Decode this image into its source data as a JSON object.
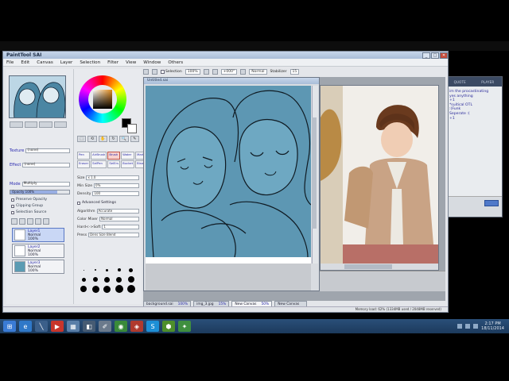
{
  "app": {
    "title": "PaintTool SAI",
    "menu": [
      "File",
      "Edit",
      "Canvas",
      "Layer",
      "Selection",
      "Filter",
      "View",
      "Window",
      "Others"
    ],
    "toolbar": {
      "zoom": "100%",
      "angle": "+000°",
      "selection_label": "Selection",
      "mode": "Normal",
      "stabilizer_label": "Stabilizer",
      "stabilizer_value": "15"
    }
  },
  "left_panel": {
    "props": [
      {
        "label": "Texture",
        "value": "(none)"
      },
      {
        "label": "Effect",
        "value": "(none)"
      },
      {
        "label": "Mode",
        "value": "Multiply"
      }
    ],
    "opacity_label": "Opacity",
    "opacity_value": "100%",
    "options": [
      "Preserve Opacity",
      "Clipping Group",
      "Selection Source"
    ],
    "layers": [
      {
        "name": "Layer1",
        "mode": "Normal",
        "opacity": "100%"
      },
      {
        "name": "Layer2",
        "mode": "Normal",
        "opacity": "100%"
      },
      {
        "name": "Layer3",
        "mode": "Normal",
        "opacity": "100%"
      }
    ]
  },
  "tools_panel": {
    "tool_icons": [
      "⬚",
      "⟲",
      "✋",
      "↻",
      "🔍",
      "✎"
    ],
    "brushes": [
      "Pen",
      "AirBrush",
      "Brush",
      "Water",
      "Marker",
      "Eraser",
      "SelPen",
      "SelErs",
      "Bucket",
      "Binary"
    ],
    "selected_brush": 2,
    "props": [
      {
        "label": "Size",
        "value": "x 1.0"
      },
      {
        "label": "Min Size",
        "value": "0%"
      },
      {
        "label": "Density",
        "value": "100"
      }
    ],
    "advanced_label": "Advanced Settings",
    "adv_props": [
      {
        "label": "Algorithm",
        "value": "Accurate"
      },
      {
        "label": "Color Mixer",
        "value": "Normal"
      },
      {
        "label": "Hard<->Soft",
        "value": "1"
      },
      {
        "label": "Press",
        "value": "Dens Size Blend"
      }
    ]
  },
  "canvas": {
    "doc_title": "Untitled.sai"
  },
  "doc_tabs": [
    {
      "name": "background.sai",
      "zoom": "100%",
      "active": false
    },
    {
      "name": "img_3.jpg",
      "zoom": "15%",
      "active": false
    },
    {
      "name": "New Canvas",
      "zoom": "50%",
      "active": true
    },
    {
      "name": "New Canvas",
      "zoom": "",
      "active": false
    }
  ],
  "status": "Memory load: 62% (1334MB used / 2048MB reserved)",
  "chat": {
    "tabs": [
      "QUOTE",
      "PLAYER"
    ],
    "lines": [
      "im the procastinating",
      "yes anything",
      "+1",
      "*suitical OTL",
      ":(Funk",
      "Seperate :(",
      "+1"
    ]
  },
  "taskbar": {
    "icons": [
      {
        "name": "start",
        "glyph": "⊞",
        "color": "#3a7bd5"
      },
      {
        "name": "ie",
        "glyph": "e",
        "color": "#2f78c8"
      },
      {
        "name": "pen",
        "glyph": "╲",
        "color": "#3b5f8a"
      },
      {
        "name": "media",
        "glyph": "▶",
        "color": "#c8352b"
      },
      {
        "name": "files",
        "glyph": "▦",
        "color": "#5a7fa8"
      },
      {
        "name": "app",
        "glyph": "◧",
        "color": "#465b73"
      },
      {
        "name": "sai",
        "glyph": "✐",
        "color": "#6b7a8c"
      },
      {
        "name": "chrome",
        "glyph": "◉",
        "color": "#3a8a3a"
      },
      {
        "name": "game",
        "glyph": "◈",
        "color": "#b03a2e"
      },
      {
        "name": "skype",
        "glyph": "S",
        "color": "#1d8fd6"
      },
      {
        "name": "android",
        "glyph": "⬢",
        "color": "#4e8f2b"
      },
      {
        "name": "other",
        "glyph": "✦",
        "color": "#3f8f3f"
      }
    ],
    "time": "2:17 PM",
    "date": "18/11/2014"
  }
}
